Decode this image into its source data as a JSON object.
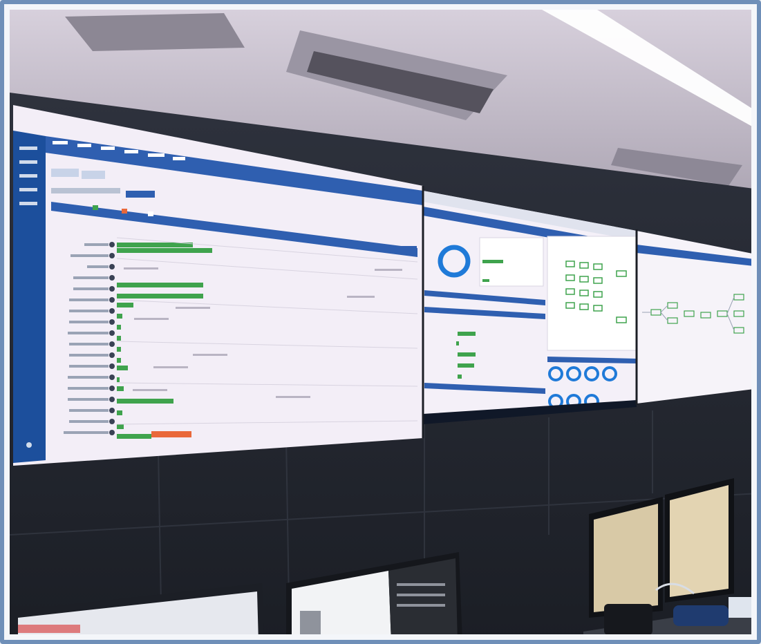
{
  "scene": {
    "description_tag": "control-room-video-wall",
    "colors": {
      "ceiling": "#c9c2cf",
      "wall": "#262a33",
      "screen_bg": "#f3eef7",
      "header_blue": "#2f5fb0",
      "bar_green": "#3fa34d",
      "bar_orange": "#e9683a",
      "ring_blue": "#1f7ad8"
    }
  }
}
